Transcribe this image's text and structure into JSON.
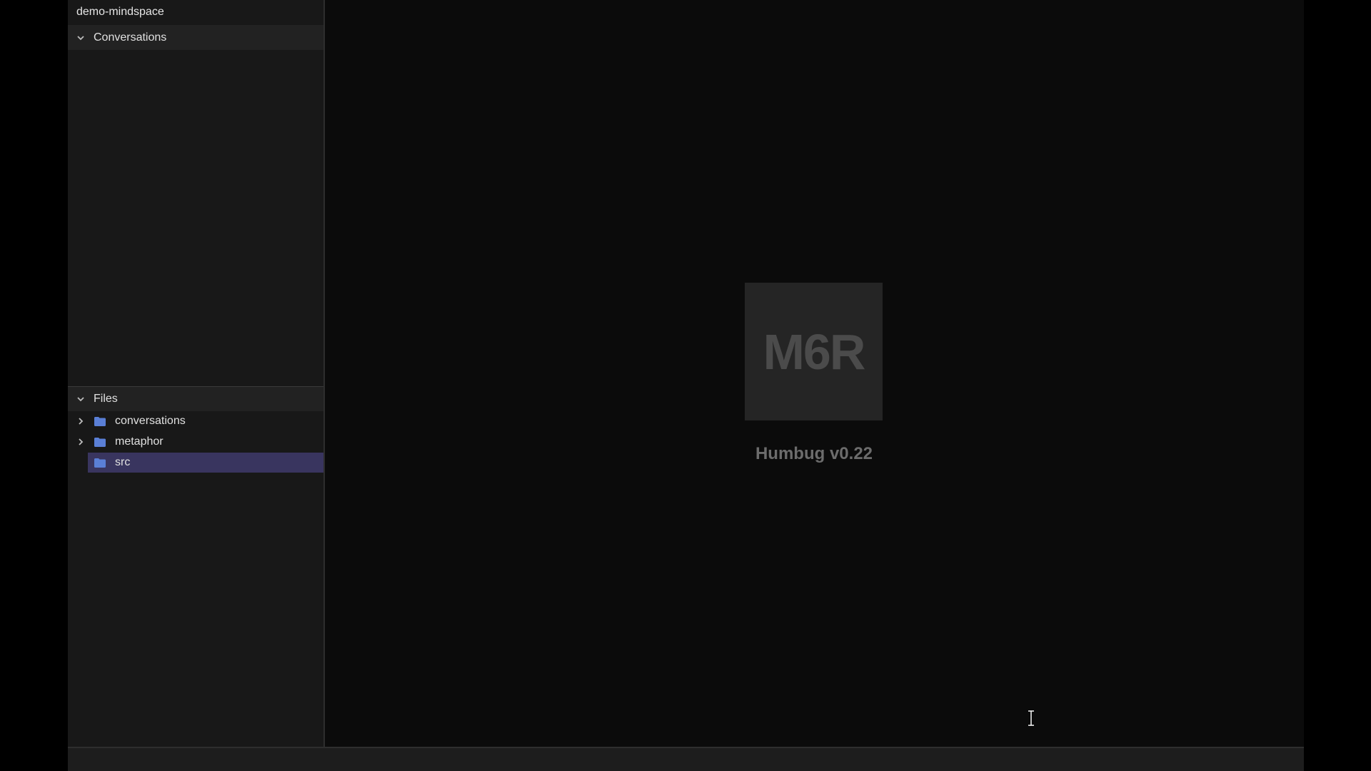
{
  "workspace": {
    "title": "demo-mindspace"
  },
  "sidebar": {
    "sections": [
      {
        "label": "Conversations",
        "expanded": true,
        "icon": "chevron-down-icon"
      },
      {
        "label": "Files",
        "expanded": true,
        "icon": "chevron-down-icon"
      }
    ],
    "files": [
      {
        "label": "conversations",
        "type": "folder",
        "expandable": true,
        "selected": false,
        "icon": "folder-icon"
      },
      {
        "label": "metaphor",
        "type": "folder",
        "expandable": true,
        "selected": false,
        "icon": "folder-icon"
      },
      {
        "label": "src",
        "type": "folder",
        "expandable": false,
        "selected": true,
        "icon": "folder-icon"
      }
    ]
  },
  "main": {
    "logo_text": "M6R",
    "app_version": "Humbug v0.22"
  },
  "colors": {
    "background": "#0b0b0b",
    "sidebar": "#181818",
    "section_header": "#222222",
    "selection": "#39355f",
    "folder": "#5a7fd6",
    "logo_box": "#252525"
  }
}
